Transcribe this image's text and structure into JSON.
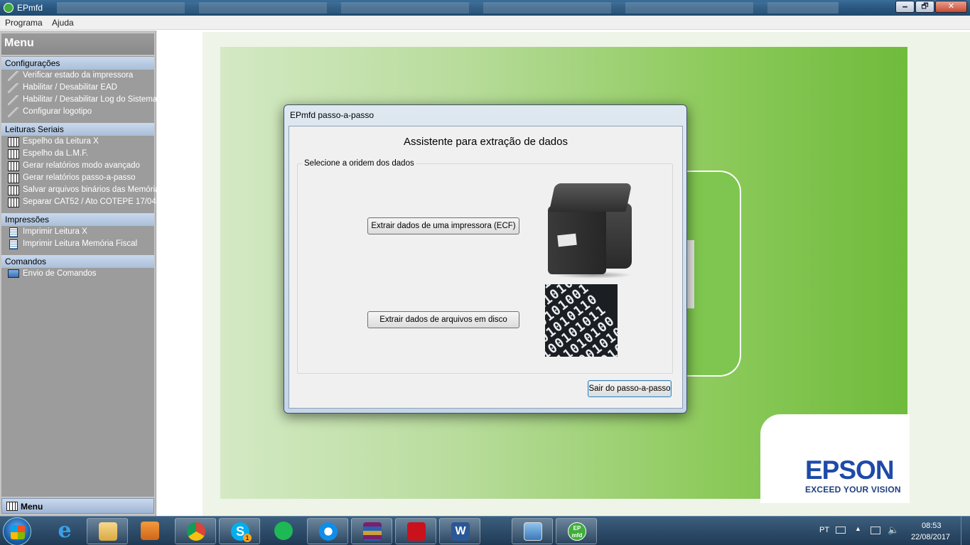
{
  "window": {
    "title": "EPmfd",
    "minimize": "🗕",
    "maximize": "🗗",
    "close": "✕"
  },
  "menubar": {
    "programa": "Programa",
    "ajuda": "Ajuda"
  },
  "sidebar": {
    "title": "Menu",
    "sections": [
      {
        "label": "Configurações",
        "items": [
          "Verificar estado da impressora",
          "Habilitar / Desabilitar EAD",
          "Habilitar / Desabilitar Log do Sistema",
          "Configurar logotipo"
        ]
      },
      {
        "label": "Leituras Seriais",
        "items": [
          "Espelho da Leitura X",
          "Espelho da L.M.F.",
          "Gerar relatórios modo avançado",
          "Gerar relatórios passo-a-passo",
          "Salvar arquivos binários das Memórias",
          "Separar CAT52 / Ato COTEPE 17/04"
        ]
      },
      {
        "label": "Impressões",
        "items": [
          "Imprimir Leitura X",
          "Imprimir Leitura Memória Fiscal"
        ]
      },
      {
        "label": "Comandos",
        "items": [
          "Envio de Comandos"
        ]
      }
    ],
    "bottom_tab": "Menu"
  },
  "brand": {
    "name": "EPSON",
    "tagline": "EXCEED YOUR VISION"
  },
  "dialog": {
    "title": "EPmfd passo-a-passo",
    "heading": "Assistente para extração de dados",
    "group_label": "Selecione a oridem dos dados",
    "btn_printer": "Extrair dados de uma impressora (ECF)",
    "btn_files": "Extrair dados de arquivos em disco",
    "btn_exit": "Sair do passo-a-passo",
    "binary_rows": [
      "10101001010",
      "01010110101",
      "10010101001",
      "01101010110",
      "10100101011",
      "01011010100",
      "10101001010",
      "01010110101",
      "10010101001"
    ]
  },
  "taskbar": {
    "apps": [
      "internet-explorer",
      "file-explorer",
      "media-player",
      "chrome",
      "skype",
      "spotify",
      "teamviewer",
      "winrar",
      "acrobat",
      "word",
      "image-viewer",
      "epmfd"
    ],
    "skype_badge": "1",
    "epmfd_label": "EP mfd",
    "language": "PT",
    "time": "08:53",
    "date": "22/08/2017"
  }
}
